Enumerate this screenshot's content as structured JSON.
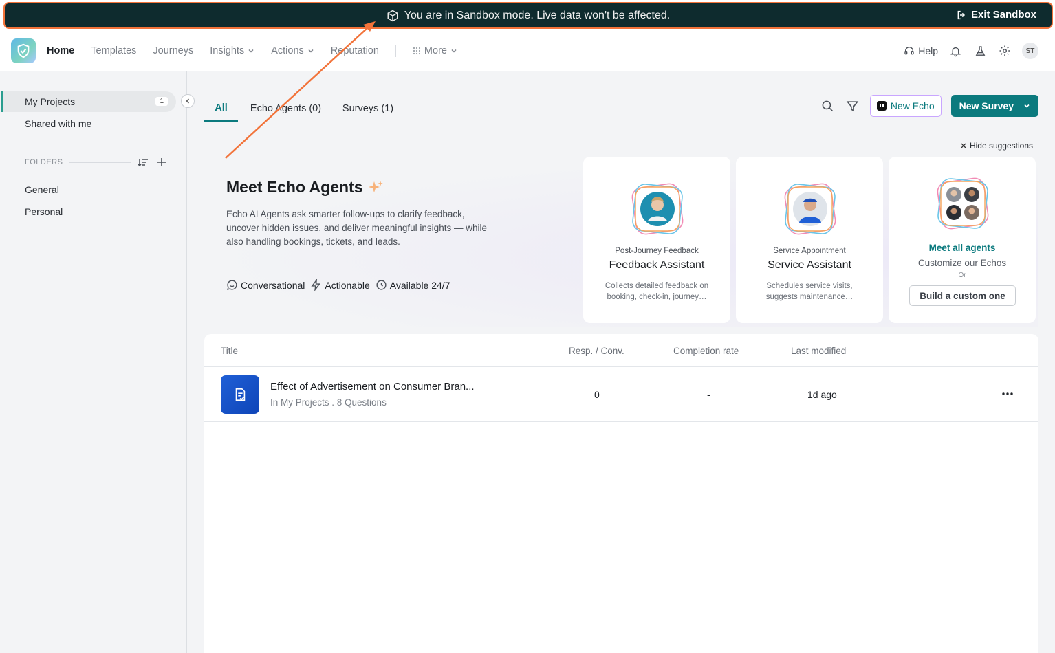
{
  "banner": {
    "message": "You are in Sandbox mode. Live data won't be affected.",
    "exit_label": "Exit Sandbox"
  },
  "nav": {
    "items": [
      {
        "label": "Home",
        "active": true
      },
      {
        "label": "Templates"
      },
      {
        "label": "Journeys"
      },
      {
        "label": "Insights"
      },
      {
        "label": "Actions"
      },
      {
        "label": "Reputation"
      },
      {
        "label": "More"
      }
    ],
    "help_label": "Help",
    "avatar_initials": "ST"
  },
  "sidebar": {
    "my_projects": "My Projects",
    "my_projects_count": "1",
    "shared": "Shared with me",
    "folders_heading": "FOLDERS",
    "folders": [
      "General",
      "Personal"
    ]
  },
  "tabs": [
    "All",
    "Echo Agents (0)",
    "Surveys (1)"
  ],
  "toolbar": {
    "new_echo": "New Echo",
    "new_survey": "New Survey"
  },
  "suggestions": {
    "hide_label": "Hide suggestions",
    "title": "Meet Echo Agents",
    "description": "Echo AI Agents ask smarter follow-ups to clarify feedback, uncover hidden issues, and deliver meaningful insights — while also handling bookings, tickets, and leads.",
    "features": [
      "Conversational",
      "Actionable",
      "Available 24/7"
    ],
    "cards": [
      {
        "kicker": "Post-Journey Feedback",
        "name": "Feedback Assistant",
        "desc": "Collects detailed feedback on booking, check-in, journey…"
      },
      {
        "kicker": "Service Appointment",
        "name": "Service Assistant",
        "desc": "Schedules service visits, suggests maintenance…"
      }
    ],
    "meet_all": "Meet all agents",
    "customize": "Customize our Echos",
    "or": "Or",
    "build": "Build a custom one"
  },
  "table": {
    "headers": [
      "Title",
      "Resp. / Conv.",
      "Completion rate",
      "Last modified"
    ],
    "rows": [
      {
        "title": "Effect of Advertisement on Consumer Bran...",
        "subtitle": "In My Projects . 8 Questions",
        "responses": "0",
        "completion": "-",
        "modified": "1d ago"
      }
    ]
  },
  "colors": {
    "accent": "#0b7a7e",
    "banner_bg": "#0e2b2e",
    "highlight": "#f2733a"
  }
}
